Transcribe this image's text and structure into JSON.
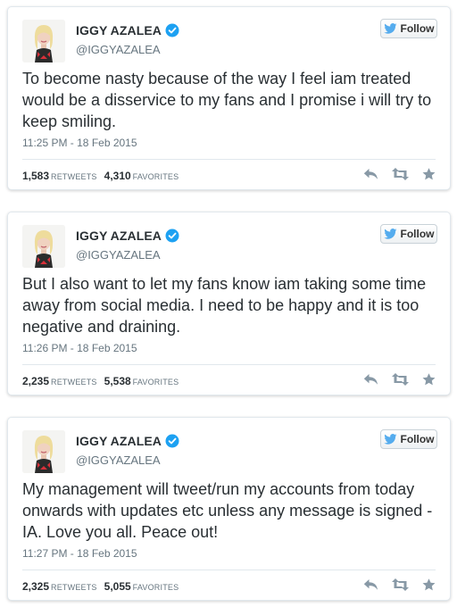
{
  "colors": {
    "verified_badge": "#1da1f2",
    "twitter_bird": "#55acee",
    "action_icon": "#8899a6",
    "text": "#292f33",
    "muted": "#66757f"
  },
  "tweets": [
    {
      "name": "IGGY AZALEA",
      "handle": "@IGGYAZALEA",
      "follow_label": "Follow",
      "text": "To become nasty because of the way I feel iam treated would be a disservice to my fans and I promise i will try to keep smiling.",
      "timestamp": "11:25 PM - 18 Feb 2015",
      "retweets": "1,583",
      "retweets_label": "RETWEETS",
      "favorites": "4,310",
      "favorites_label": "FAVORITES"
    },
    {
      "name": "IGGY AZALEA",
      "handle": "@IGGYAZALEA",
      "follow_label": "Follow",
      "text": "But I also want to let my fans know iam taking some time away from social media. I need to be happy and it is too negative and draining.",
      "timestamp": "11:26 PM - 18 Feb 2015",
      "retweets": "2,235",
      "retweets_label": "RETWEETS",
      "favorites": "5,538",
      "favorites_label": "FAVORITES"
    },
    {
      "name": "IGGY AZALEA",
      "handle": "@IGGYAZALEA",
      "follow_label": "Follow",
      "text": "My management will tweet/run my accounts from today onwards with updates etc unless any message is signed -IA. Love you all. Peace out!",
      "timestamp": "11:27 PM - 18 Feb 2015",
      "retweets": "2,325",
      "retweets_label": "RETWEETS",
      "favorites": "5,055",
      "favorites_label": "FAVORITES"
    }
  ]
}
